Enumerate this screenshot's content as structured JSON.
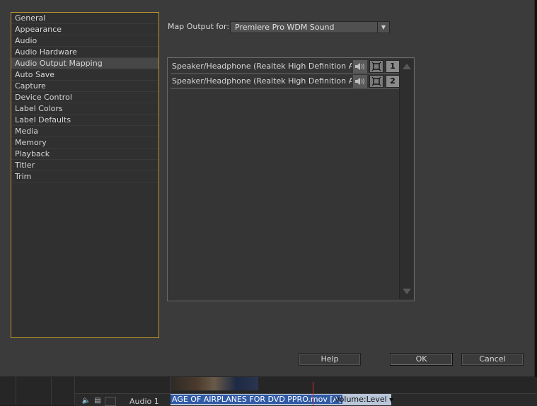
{
  "sidebar": {
    "items": [
      {
        "label": "General"
      },
      {
        "label": "Appearance"
      },
      {
        "label": "Audio"
      },
      {
        "label": "Audio Hardware"
      },
      {
        "label": "Audio Output Mapping",
        "selected": true
      },
      {
        "label": "Auto Save"
      },
      {
        "label": "Capture"
      },
      {
        "label": "Device Control"
      },
      {
        "label": "Label Colors"
      },
      {
        "label": "Label Defaults"
      },
      {
        "label": "Media"
      },
      {
        "label": "Memory"
      },
      {
        "label": "Playback"
      },
      {
        "label": "Titler"
      },
      {
        "label": "Trim"
      }
    ]
  },
  "mapping": {
    "label": "Map Output for:",
    "selected_device": "Premiere Pro WDM Sound",
    "outputs": [
      {
        "label": "Speaker/Headphone (Realtek High Definition Au...",
        "channel": "1"
      },
      {
        "label": "Speaker/Headphone (Realtek High Definition Au...",
        "channel": "2"
      }
    ]
  },
  "buttons": {
    "help": "Help",
    "ok": "OK",
    "cancel": "Cancel"
  },
  "background": {
    "track_name": "Audio 1",
    "clip_name": "AGE OF AIRPLANES FOR DVD PPRO.mov [A]",
    "clip_volume": "Volume:Level"
  },
  "colors": {
    "selection_border": "#b8942c",
    "playhead": "#d8283a",
    "clip_highlight": "#2f5aa6"
  }
}
